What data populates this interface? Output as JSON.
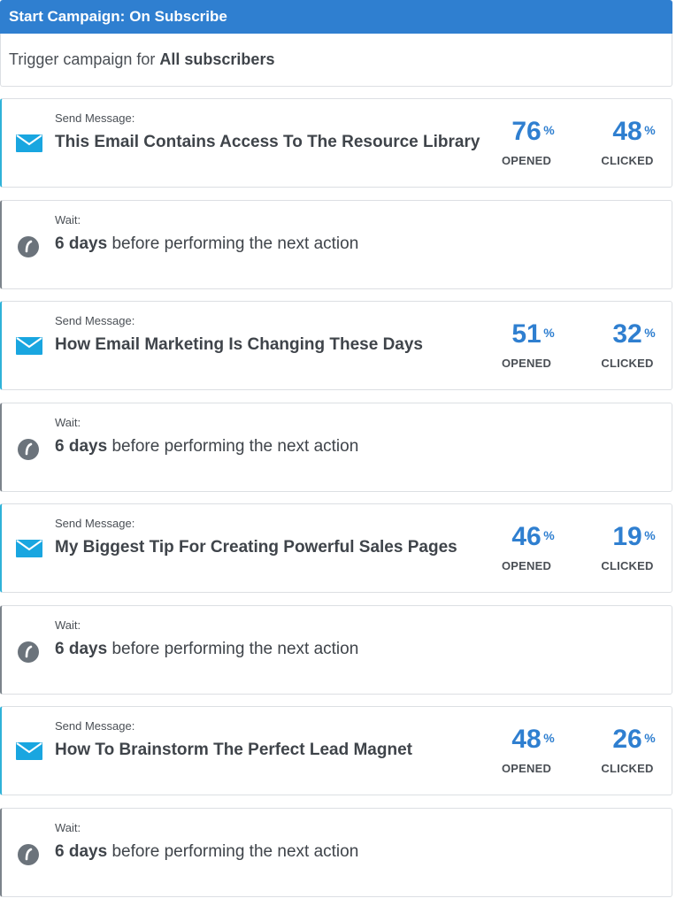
{
  "header": {
    "label": "Start Campaign:",
    "value": "On Subscribe",
    "color": "#2f7fd0"
  },
  "trigger": {
    "label": "Trigger campaign for",
    "value": "All subscribers"
  },
  "steps": [
    {
      "type": "message",
      "kicker": "Send Message:",
      "title": "This Email Contains Access To The Resource Library",
      "opened": "76",
      "clicked": "48"
    },
    {
      "type": "wait",
      "kicker": "Wait:",
      "duration": "6 days",
      "rest": "before performing the next action"
    },
    {
      "type": "message",
      "kicker": "Send Message:",
      "title": "How Email Marketing Is Changing These Days",
      "opened": "51",
      "clicked": "32"
    },
    {
      "type": "wait",
      "kicker": "Wait:",
      "duration": "6 days",
      "rest": "before performing the next action"
    },
    {
      "type": "message",
      "kicker": "Send Message:",
      "title": "My Biggest Tip For Creating Powerful Sales Pages",
      "opened": "46",
      "clicked": "19"
    },
    {
      "type": "wait",
      "kicker": "Wait:",
      "duration": "6 days",
      "rest": "before performing the next action"
    },
    {
      "type": "message",
      "kicker": "Send Message:",
      "title": "How To Brainstorm The Perfect Lead Magnet",
      "opened": "48",
      "clicked": "26"
    },
    {
      "type": "wait",
      "kicker": "Wait:",
      "duration": "6 days",
      "rest": "before performing the next action"
    }
  ],
  "labels": {
    "opened": "OPENED",
    "clicked": "CLICKED",
    "percent": "%"
  },
  "icons": {
    "message": "envelope-icon",
    "wait": "clock-icon"
  },
  "colors": {
    "accent": "#2f7fd0",
    "message_border": "#2fb2d8",
    "icon_mail": "#19a6e0",
    "icon_clock": "#6b737b"
  }
}
